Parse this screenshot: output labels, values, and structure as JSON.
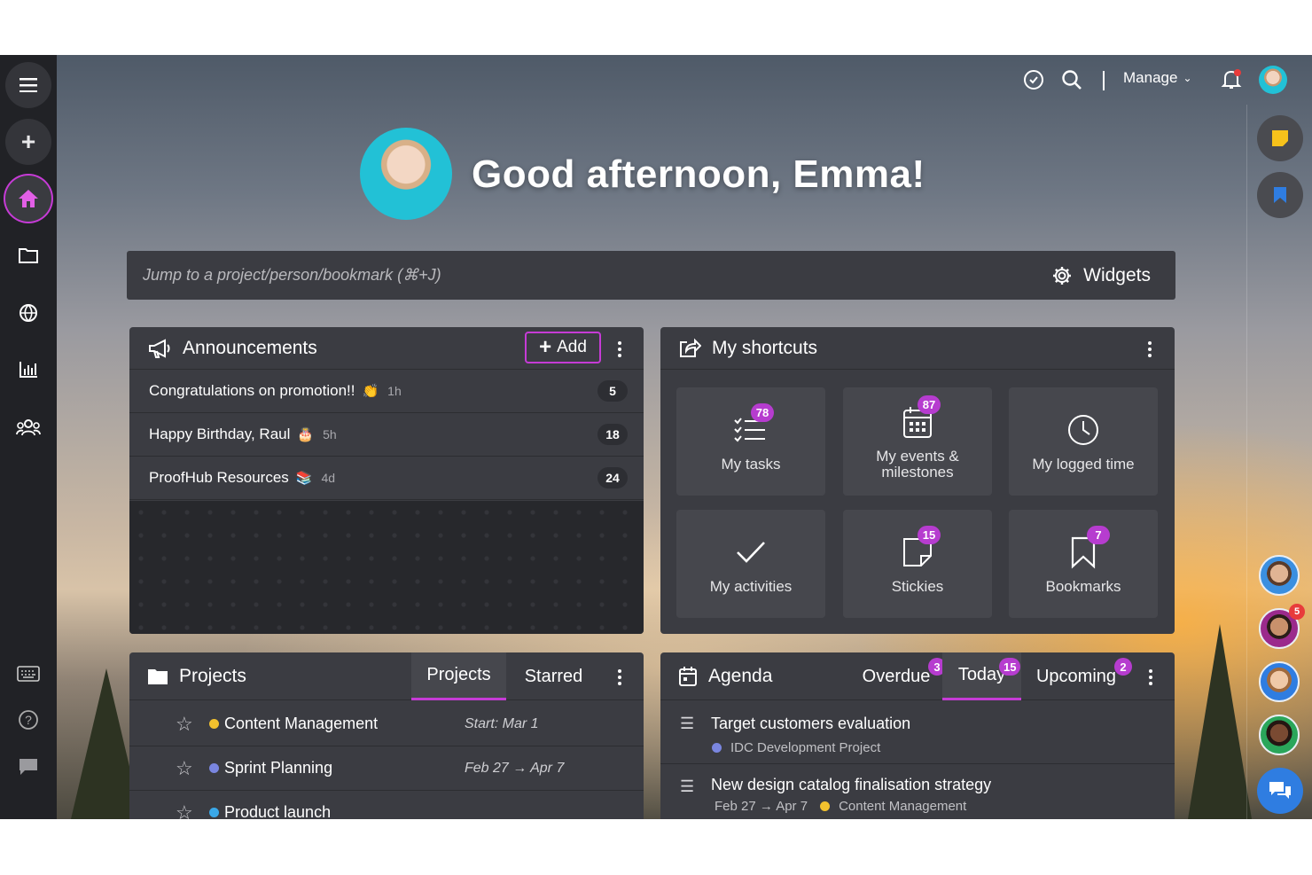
{
  "topbar": {
    "manage_label": "Manage"
  },
  "greeting": "Good afternoon, Emma!",
  "search": {
    "placeholder": "Jump to a project/person/bookmark (⌘+J)",
    "widgets_label": "Widgets"
  },
  "announcements": {
    "title": "Announcements",
    "add_label": "Add",
    "items": [
      {
        "text": "Congratulations on promotion!!",
        "emoji": "👏",
        "time": "1h",
        "count": "5"
      },
      {
        "text": "Happy Birthday, Raul",
        "emoji": "🎂",
        "time": "5h",
        "count": "18"
      },
      {
        "text": "ProofHub Resources",
        "emoji": "📚",
        "time": "4d",
        "count": "24"
      }
    ]
  },
  "shortcuts": {
    "title": "My shortcuts",
    "tiles": [
      {
        "label": "My tasks",
        "badge": "78",
        "icon": "task-list-icon"
      },
      {
        "label": "My events & milestones",
        "badge": "87",
        "icon": "calendar-icon"
      },
      {
        "label": "My logged time",
        "badge": "",
        "icon": "clock-icon"
      },
      {
        "label": "My activities",
        "badge": "",
        "icon": "check-icon"
      },
      {
        "label": "Stickies",
        "badge": "15",
        "icon": "sticky-note-icon"
      },
      {
        "label": "Bookmarks",
        "badge": "7",
        "icon": "bookmark-icon"
      }
    ]
  },
  "projects": {
    "title": "Projects",
    "tabs": [
      "Projects",
      "Starred"
    ],
    "rows": [
      {
        "name": "Content Management",
        "color": "#f2c12e",
        "date": "Start: Mar 1"
      },
      {
        "name": "Sprint Planning",
        "color": "#7a86e0",
        "date": "Feb 27 → Apr 7"
      },
      {
        "name": "Product launch",
        "color": "#3aa8e8",
        "date": ""
      }
    ]
  },
  "agenda": {
    "title": "Agenda",
    "tabs": [
      {
        "label": "Overdue",
        "badge": "3"
      },
      {
        "label": "Today",
        "badge": "15"
      },
      {
        "label": "Upcoming",
        "badge": "2"
      }
    ],
    "items": [
      {
        "title": "Target customers evaluation",
        "project": "IDC Development Project",
        "dot": "#7a86e0",
        "dates": ""
      },
      {
        "title": "New design catalog finalisation strategy",
        "project": "Content Management",
        "dot": "#f2c12e",
        "dates": "Feb 27 → Apr 7"
      }
    ]
  },
  "rail": {
    "people_badge": "5"
  },
  "colors": {
    "accent": "#c63bd6",
    "panel": "#3b3c42",
    "sidebar": "#212226"
  }
}
